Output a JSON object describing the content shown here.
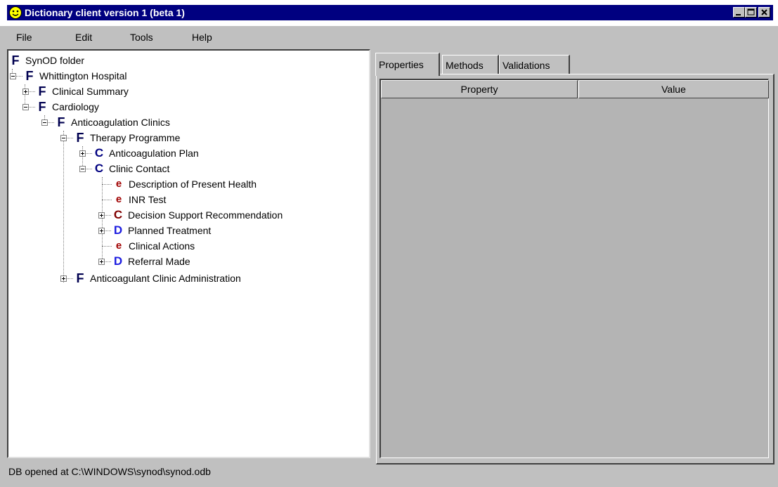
{
  "window": {
    "title": "Dictionary client version 1 (beta 1)",
    "app_icon": "smiley-icon",
    "controls": [
      "minimize-icon",
      "maximize-icon",
      "close-icon"
    ]
  },
  "menu": {
    "file": "File",
    "edit": "Edit",
    "tools": "Tools",
    "help": "Help"
  },
  "tree": {
    "root": {
      "icon": "F",
      "label": "SynOD folder"
    },
    "n1": {
      "icon": "F",
      "label": "Whittington Hospital"
    },
    "n2": {
      "icon": "F",
      "label": "Clinical Summary"
    },
    "n3": {
      "icon": "F",
      "label": "Cardiology"
    },
    "n4": {
      "icon": "F",
      "label": "Anticoagulation Clinics"
    },
    "n5": {
      "icon": "F",
      "label": "Therapy Programme"
    },
    "n6": {
      "icon": "C",
      "label": "Anticoagulation Plan"
    },
    "n7": {
      "icon": "C",
      "label": "Clinic Contact"
    },
    "n8": {
      "icon": "e",
      "label": "Description of Present Health"
    },
    "n9": {
      "icon": "e",
      "label": "INR Test"
    },
    "n10": {
      "icon": "C",
      "label": "Decision Support Recommendation"
    },
    "n11": {
      "icon": "D",
      "label": "Planned Treatment"
    },
    "n12": {
      "icon": "e",
      "label": "Clinical Actions"
    },
    "n13": {
      "icon": "D",
      "label": "Referral Made"
    },
    "n14": {
      "icon": "F",
      "label": "Anticoagulant Clinic Administration"
    }
  },
  "tabs": {
    "properties": "Properties",
    "methods": "Methods",
    "validations": "Validations"
  },
  "table": {
    "col_property": "Property",
    "col_value": "Value"
  },
  "status": {
    "text": "DB opened at C:\\WINDOWS\\synod\\synod.odb"
  },
  "colors": {
    "titlebar": "#000080",
    "window_bg": "#c0c0c0"
  }
}
